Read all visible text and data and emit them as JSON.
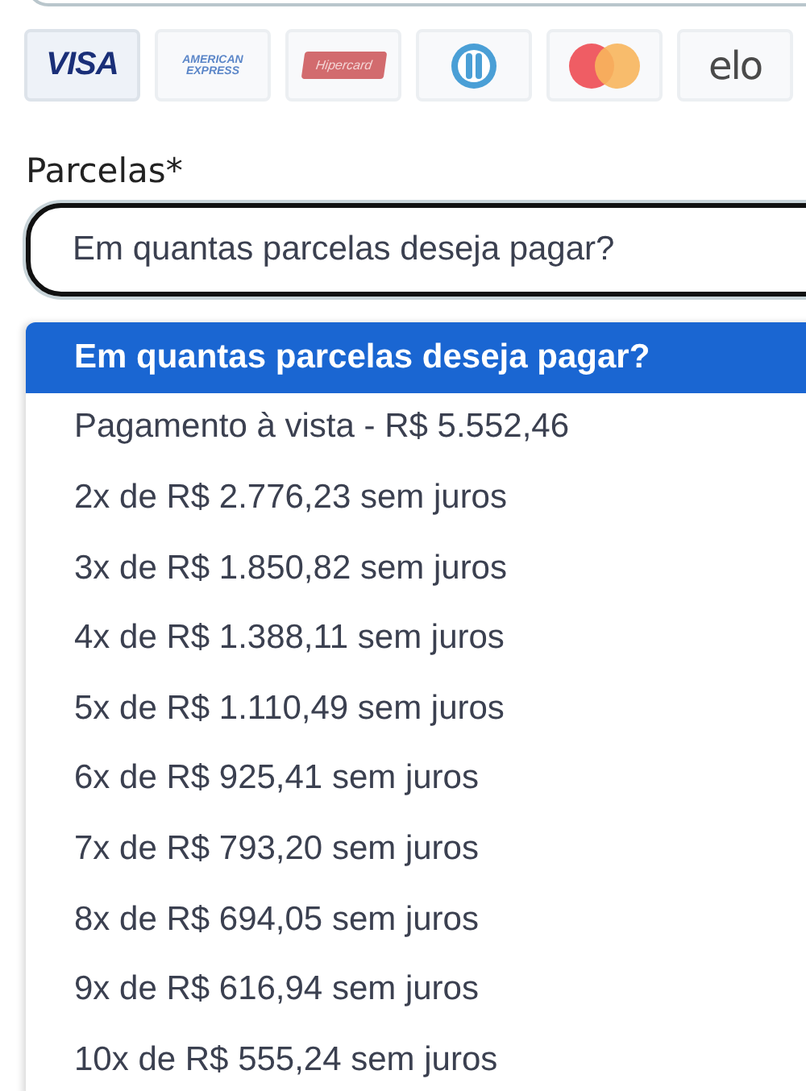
{
  "cards": [
    {
      "kind": "visa",
      "label": "VISA",
      "selected": true
    },
    {
      "kind": "amex",
      "label": "AMERICAN EXPRESS",
      "selected": false
    },
    {
      "kind": "hipercard",
      "label": "Hipercard",
      "selected": false
    },
    {
      "kind": "diners",
      "selected": false
    },
    {
      "kind": "mastercard",
      "selected": false
    },
    {
      "kind": "elo",
      "label": "elo",
      "selected": false
    }
  ],
  "installments": {
    "label": "Parcelas*",
    "value": "Em quantas parcelas deseja pagar?",
    "options": [
      {
        "label": "Em quantas parcelas deseja pagar?",
        "selected": true
      },
      {
        "label": "Pagamento à vista - R$ 5.552,46",
        "selected": false
      },
      {
        "label": "2x de R$ 2.776,23 sem juros",
        "selected": false
      },
      {
        "label": "3x de R$ 1.850,82 sem juros",
        "selected": false
      },
      {
        "label": "4x de R$ 1.388,11 sem juros",
        "selected": false
      },
      {
        "label": "5x de R$ 1.110,49 sem juros",
        "selected": false
      },
      {
        "label": "6x de R$ 925,41 sem juros",
        "selected": false
      },
      {
        "label": "7x de R$ 793,20 sem juros",
        "selected": false
      },
      {
        "label": "8x de R$ 694,05 sem juros",
        "selected": false
      },
      {
        "label": "9x de R$ 616,94 sem juros",
        "selected": false
      },
      {
        "label": "10x de R$ 555,24 sem juros",
        "selected": false
      }
    ]
  }
}
